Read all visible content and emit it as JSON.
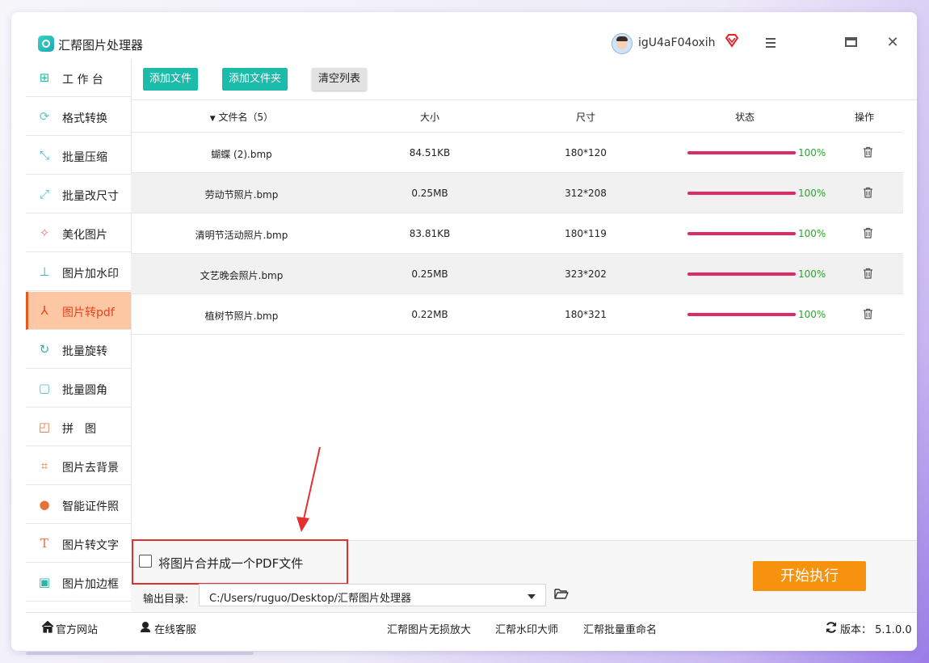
{
  "app": {
    "title": "汇帮图片处理器"
  },
  "user": {
    "name": "igU4aF04oxih"
  },
  "window_controls": {
    "close": "✕"
  },
  "sidebar": {
    "items": [
      {
        "label": "工 作 台",
        "icon": "grid-icon"
      },
      {
        "label": "格式转换",
        "icon": "convert-icon"
      },
      {
        "label": "批量压缩",
        "icon": "compress-icon"
      },
      {
        "label": "批量改尺寸",
        "icon": "resize-icon"
      },
      {
        "label": "美化图片",
        "icon": "beautify-icon"
      },
      {
        "label": "图片加水印",
        "icon": "watermark-icon"
      },
      {
        "label": "图片转pdf",
        "icon": "pdf-icon",
        "active": true
      },
      {
        "label": "批量旋转",
        "icon": "rotate-icon"
      },
      {
        "label": "批量圆角",
        "icon": "round-corner-icon"
      },
      {
        "label": "拼　图",
        "icon": "collage-icon"
      },
      {
        "label": "图片去背景",
        "icon": "crop-icon"
      },
      {
        "label": "智能证件照",
        "icon": "person-icon"
      },
      {
        "label": "图片转文字",
        "icon": "text-icon"
      },
      {
        "label": "图片加边框",
        "icon": "frame-icon"
      }
    ]
  },
  "toolbar": {
    "add_file": "添加文件",
    "add_folder": "添加文件夹",
    "clear_list": "清空列表"
  },
  "table": {
    "headers": {
      "name": "文件名（5）",
      "size": "大小",
      "dimension": "尺寸",
      "status": "状态",
      "op": "操作"
    },
    "rows": [
      {
        "name": "蝴蝶 (2).bmp",
        "size": "84.51KB",
        "dimension": "180*120",
        "progress": "100%"
      },
      {
        "name": "劳动节照片.bmp",
        "size": "0.25MB",
        "dimension": "312*208",
        "progress": "100%"
      },
      {
        "name": "清明节活动照片.bmp",
        "size": "83.81KB",
        "dimension": "180*119",
        "progress": "100%"
      },
      {
        "name": "文艺晚会照片.bmp",
        "size": "0.25MB",
        "dimension": "323*202",
        "progress": "100%"
      },
      {
        "name": "植树节照片.bmp",
        "size": "0.22MB",
        "dimension": "180*321",
        "progress": "100%"
      }
    ]
  },
  "options": {
    "merge_pdf_label": "将图片合并成一个PDF文件",
    "merge_pdf_checked": false,
    "output_label": "输出目录:",
    "output_path": "C:/Users/ruguo/Desktop/汇帮图片处理器",
    "start_button": "开始执行"
  },
  "footer": {
    "website": "官方网站",
    "support": "在线客服",
    "link1": "汇帮图片无损放大",
    "link2": "汇帮水印大师",
    "link3": "汇帮批量重命名",
    "version": "版本：  5.1.0.0"
  },
  "colors": {
    "accent_green": "#1cbcab",
    "active_bg": "#fcc7a2",
    "progress": "#dc2a6a",
    "start": "#f7920f",
    "annotation_red": "#e23030"
  }
}
